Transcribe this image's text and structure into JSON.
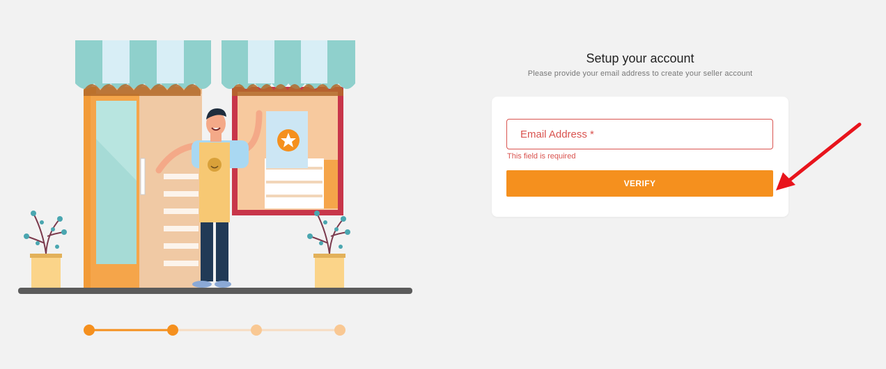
{
  "header": {
    "title": "Setup your account",
    "subtitle": "Please provide your email address to create your seller account"
  },
  "form": {
    "email_placeholder": "Email Address *",
    "email_value": "",
    "error_text": "This field is required",
    "verify_label": "VERIFY"
  },
  "stepper": {
    "total_steps": 4,
    "current_step": 2
  },
  "colors": {
    "accent": "#f5901e",
    "error": "#d9534f",
    "background": "#f2f2f2",
    "annotation_arrow": "#e8141c"
  },
  "icons": {
    "illustration": "shopkeeper-storefront-illustration",
    "arrow": "red-pointer-arrow"
  }
}
